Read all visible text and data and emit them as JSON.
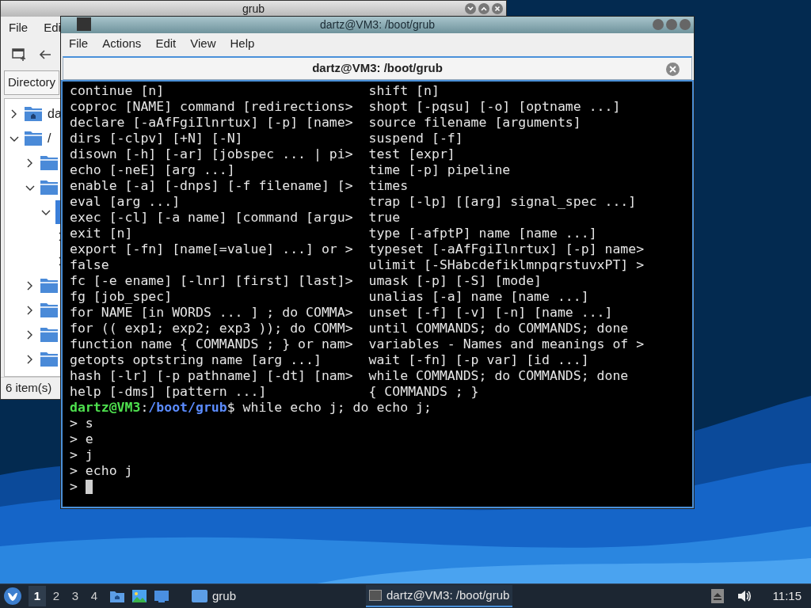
{
  "file_manager": {
    "title": "grub",
    "menu": [
      "File",
      "Edi"
    ],
    "location_tab": "Directory",
    "tree": [
      {
        "kind": "home",
        "label": "da",
        "expanded": false,
        "selected": false
      },
      {
        "kind": "folder",
        "label": "/",
        "expanded": true,
        "selected": false,
        "children": [
          {
            "kind": "folder",
            "expanded": false,
            "selected": false
          },
          {
            "kind": "folder",
            "expanded": true,
            "selected": false,
            "children": [
              {
                "kind": "folder",
                "expanded": true,
                "selected": true,
                "children": [
                  {
                    "expanded": false,
                    "selected": false
                  },
                  {
                    "expanded": false,
                    "selected": false
                  }
                ]
              }
            ]
          },
          {
            "kind": "folder",
            "expanded": false,
            "selected": false
          },
          {
            "kind": "folder",
            "expanded": false,
            "selected": false
          },
          {
            "kind": "folder",
            "expanded": false,
            "selected": false
          },
          {
            "kind": "folder",
            "expanded": false,
            "selected": false
          }
        ]
      }
    ],
    "status": "6 item(s)"
  },
  "terminal": {
    "title": "dartz@VM3: /boot/grub",
    "menu": [
      "File",
      "Actions",
      "Edit",
      "View",
      "Help"
    ],
    "tab": "dartz@VM3: /boot/grub",
    "help_rows": [
      {
        "left": "continue [n]",
        "right": "shift [n]"
      },
      {
        "left": "coproc [NAME] command [redirections>",
        "right": "shopt [-pqsu] [-o] [optname ...]"
      },
      {
        "left": "declare [-aAfFgiIlnrtux] [-p] [name>",
        "right": "source filename [arguments]"
      },
      {
        "left": "dirs [-clpv] [+N] [-N]",
        "right": "suspend [-f]"
      },
      {
        "left": "disown [-h] [-ar] [jobspec ... | pi>",
        "right": "test [expr]"
      },
      {
        "left": "echo [-neE] [arg ...]",
        "right": "time [-p] pipeline"
      },
      {
        "left": "enable [-a] [-dnps] [-f filename] [>",
        "right": "times"
      },
      {
        "left": "eval [arg ...]",
        "right": "trap [-lp] [[arg] signal_spec ...]"
      },
      {
        "left": "exec [-cl] [-a name] [command [argu>",
        "right": "true"
      },
      {
        "left": "exit [n]",
        "right": "type [-afptP] name [name ...]"
      },
      {
        "left": "export [-fn] [name[=value] ...] or >",
        "right": "typeset [-aAfFgiIlnrtux] [-p] name>"
      },
      {
        "left": "false",
        "right": "ulimit [-SHabcdefiklmnpqrstuvxPT] >"
      },
      {
        "left": "fc [-e ename] [-lnr] [first] [last]>",
        "right": "umask [-p] [-S] [mode]"
      },
      {
        "left": "fg [job_spec]",
        "right": "unalias [-a] name [name ...]"
      },
      {
        "left": "for NAME [in WORDS ... ] ; do COMMA>",
        "right": "unset [-f] [-v] [-n] [name ...]"
      },
      {
        "left": "for (( exp1; exp2; exp3 )); do COMM>",
        "right": "until COMMANDS; do COMMANDS; done"
      },
      {
        "left": "function name { COMMANDS ; } or nam>",
        "right": "variables - Names and meanings of >"
      },
      {
        "left": "getopts optstring name [arg ...]",
        "right": "wait [-fn] [-p var] [id ...]"
      },
      {
        "left": "hash [-lr] [-p pathname] [-dt] [nam>",
        "right": "while COMMANDS; do COMMANDS; done"
      },
      {
        "left": "help [-dms] [pattern ...]",
        "right": "{ COMMANDS ; }"
      }
    ],
    "prompt": {
      "user_host": "dartz@VM3",
      "separator": ":",
      "path": "/boot/grub",
      "symbol": "$",
      "command": "while echo j; do echo j;"
    },
    "continuations": [
      {
        "prompt": ">",
        "text": "s"
      },
      {
        "prompt": ">",
        "text": "e"
      },
      {
        "prompt": ">",
        "text": "j"
      },
      {
        "prompt": ">",
        "text": "echo j"
      }
    ],
    "input_prompt": ">"
  },
  "taskbar": {
    "workspaces": [
      {
        "label": "1",
        "selected": true
      },
      {
        "label": "2",
        "selected": false
      },
      {
        "label": "3",
        "selected": false
      },
      {
        "label": "4",
        "selected": false
      }
    ],
    "tasks": [
      {
        "label": "grub",
        "kind": "folder",
        "selected": false
      },
      {
        "label": "dartz@VM3: /boot/grub",
        "kind": "terminal",
        "selected": true
      }
    ],
    "clock": "11:15"
  }
}
